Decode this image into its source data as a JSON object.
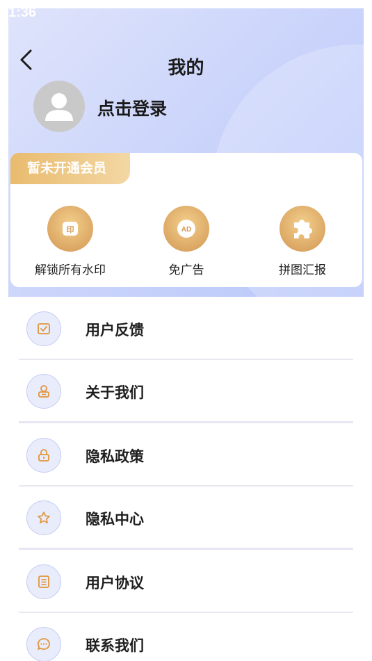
{
  "status_bar": {
    "time": "1:36"
  },
  "header": {
    "title": "我的",
    "login_text": "点击登录"
  },
  "vip": {
    "badge": "暂未开通会员",
    "benefits": [
      {
        "icon": "watermark-icon",
        "label": "解锁所有水印"
      },
      {
        "icon": "ad-icon",
        "label": "免广告"
      },
      {
        "icon": "puzzle-icon",
        "label": "拼图汇报"
      }
    ]
  },
  "menu": {
    "items": [
      {
        "icon": "feedback-icon",
        "label": "用户反馈"
      },
      {
        "icon": "about-icon",
        "label": "关于我们"
      },
      {
        "icon": "lock-icon",
        "label": "隐私政策"
      },
      {
        "icon": "star-icon",
        "label": "隐私中心"
      },
      {
        "icon": "document-icon",
        "label": "用户协议"
      },
      {
        "icon": "chat-icon",
        "label": "联系我们"
      }
    ]
  },
  "colors": {
    "header_gradient_start": "#dfe4fb",
    "header_gradient_end": "#b8c6fa",
    "gold": "#dca764",
    "icon_orange": "#e2953b"
  }
}
